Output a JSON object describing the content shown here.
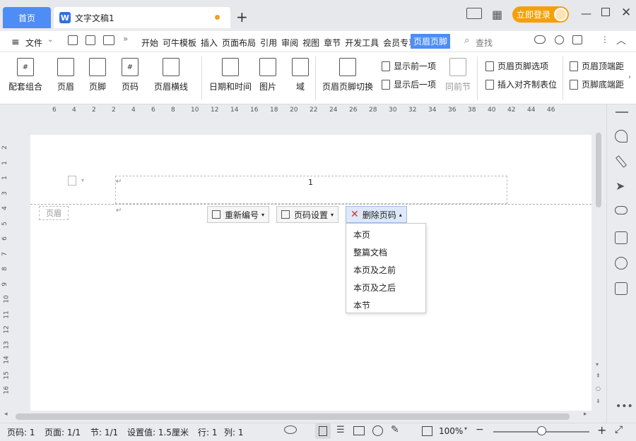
{
  "tabs": {
    "home": "首页",
    "doc": "文字文稿1"
  },
  "titlebar": {
    "login": "立即登录"
  },
  "menu": {
    "file": "文件",
    "items": [
      "开始",
      "可牛模板",
      "插入",
      "页面布局",
      "引用",
      "审阅",
      "视图",
      "章节",
      "开发工具",
      "会员专享"
    ],
    "active": "页眉页脚",
    "search": "查找"
  },
  "ribbon": {
    "big": [
      "配套组合",
      "页眉",
      "页脚",
      "页码",
      "页眉横线",
      "日期和时间",
      "图片",
      "域",
      "页眉页脚切换"
    ],
    "show_prev": "显示前一项",
    "show_next": "显示后一项",
    "same_prev": "同前节",
    "hf_options": "页眉页脚选项",
    "insert_tab": "插入对齐制表位",
    "header_top": "页眉顶端距",
    "footer_bottom": "页脚底端距"
  },
  "ruler": [
    "6",
    "4",
    "2",
    "2",
    "4",
    "6",
    "8",
    "10",
    "12",
    "14",
    "16",
    "18",
    "20",
    "22",
    "24",
    "26",
    "28",
    "30",
    "32",
    "34",
    "36",
    "38",
    "40",
    "42",
    "44",
    "46"
  ],
  "vruler": [
    "2",
    "1",
    "1",
    "3",
    "4",
    "5",
    "6",
    "7",
    "8",
    "9",
    "10",
    "11",
    "12",
    "13",
    "14",
    "15",
    "16"
  ],
  "document": {
    "page_number": "1",
    "header_label": "页眉",
    "renumber": "重新编号",
    "page_settings": "页码设置",
    "delete_page_number": "删除页码",
    "dropdown": [
      "本页",
      "整篇文档",
      "本页及之前",
      "本页及之后",
      "本节"
    ]
  },
  "status": {
    "page": "页码: 1",
    "pages": "页面: 1/1",
    "section": "节: 1/1",
    "setting": "设置值: 1.5厘米",
    "row": "行: 1",
    "col": "列: 1",
    "zoom": "100%",
    "zoom_level": 0.5
  },
  "colors": {
    "accent": "#4e8df5",
    "login": "#f5a00b"
  }
}
